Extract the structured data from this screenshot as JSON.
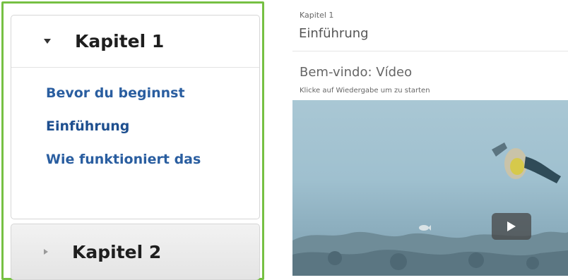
{
  "sidebar": {
    "chapters": [
      {
        "title": "Kapitel 1",
        "expanded": true,
        "lessons": [
          {
            "label": "Bevor du beginnst",
            "active": false
          },
          {
            "label": "Einführung",
            "active": true
          },
          {
            "label": "Wie funktioniert das",
            "active": false
          }
        ]
      },
      {
        "title": "Kapitel 2",
        "expanded": false
      }
    ]
  },
  "main": {
    "breadcrumb": "Kapitel 1",
    "lesson_title": "Einführung",
    "section_title": "Bem-vindo: Vídeo",
    "hint": "Klicke auf Wiedergabe um zu starten"
  },
  "icons": {
    "chapter1_toggle": "caret-down-icon",
    "chapter2_toggle": "caret-right-icon",
    "play": "play-icon"
  },
  "colors": {
    "nav_border": "#76c043",
    "lesson_link": "#2a5ea0"
  }
}
